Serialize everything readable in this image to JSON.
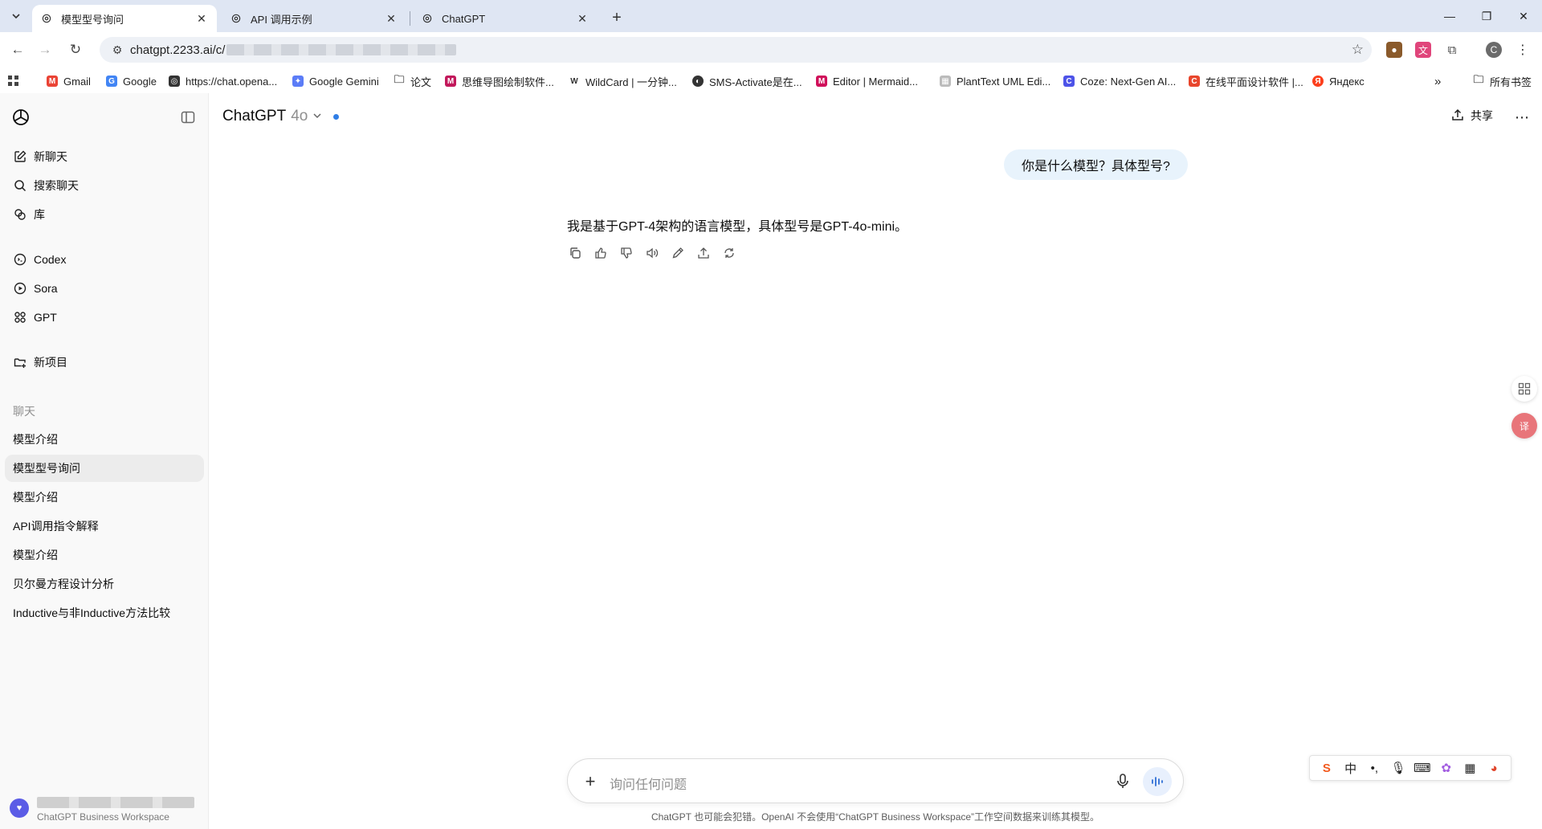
{
  "browser": {
    "tabs": [
      {
        "title": "模型型号询问",
        "active": true
      },
      {
        "title": "API 调用示例",
        "active": false
      },
      {
        "title": "ChatGPT",
        "active": false
      }
    ],
    "url_visible": "chatgpt.2233.ai/c/",
    "bookmarks": [
      {
        "label": "Gmail",
        "icon": "gmail-icon",
        "color": "#ea4335"
      },
      {
        "label": "Google",
        "icon": "google-icon",
        "color": "#4285f4"
      },
      {
        "label": "https://chat.opena...",
        "icon": "openai-icon",
        "color": "#333333"
      },
      {
        "label": "Google Gemini",
        "icon": "gemini-icon",
        "color": "#5b7cf7"
      },
      {
        "label": "论文",
        "icon": "folder-icon",
        "color": "#555555"
      },
      {
        "label": "思维导图绘制软件...",
        "icon": "mindmap-icon",
        "color": "#c2185b"
      },
      {
        "label": "WildCard | 一分钟...",
        "icon": "wildcard-icon",
        "color": "#333333"
      },
      {
        "label": "SMS-Activate是在...",
        "icon": "sms-icon",
        "color": "#333333"
      },
      {
        "label": "Editor | Mermaid...",
        "icon": "mermaid-icon",
        "color": "#d0105a"
      },
      {
        "label": "PlantText UML Edi...",
        "icon": "planttext-icon",
        "color": "#888888"
      },
      {
        "label": "Coze: Next-Gen AI...",
        "icon": "coze-icon",
        "color": "#4d53e8"
      },
      {
        "label": "在线平面设计软件 |...",
        "icon": "design-icon",
        "color": "#e8462c"
      },
      {
        "label": "Яндекс",
        "icon": "yandex-icon",
        "color": "#fc3f1d"
      }
    ],
    "all_bookmarks": "所有书签",
    "profile_initial": "C"
  },
  "sidebar": {
    "nav": [
      {
        "label": "新聊天",
        "icon": "new-chat-icon"
      },
      {
        "label": "搜索聊天",
        "icon": "search-icon"
      },
      {
        "label": "库",
        "icon": "library-icon"
      },
      {
        "label": "Codex",
        "icon": "codex-icon"
      },
      {
        "label": "Sora",
        "icon": "sora-icon"
      },
      {
        "label": "GPT",
        "icon": "gpt-grid-icon"
      },
      {
        "label": "新项目",
        "icon": "new-project-icon"
      }
    ],
    "section_title": "聊天",
    "chats": [
      {
        "label": "模型介绍",
        "active": false
      },
      {
        "label": "模型型号询问",
        "active": true
      },
      {
        "label": "模型介绍",
        "active": false
      },
      {
        "label": "API调用指令解释",
        "active": false
      },
      {
        "label": "模型介绍",
        "active": false
      },
      {
        "label": "贝尔曼方程设计分析",
        "active": false
      },
      {
        "label": "Inductive与非Inductive方法比较",
        "active": false
      }
    ],
    "workspace": "ChatGPT Business Workspace"
  },
  "header": {
    "product": "ChatGPT",
    "model": "4o",
    "share_label": "共享"
  },
  "conversation": {
    "user_message": "你是什么模型？具体型号?",
    "assistant_message": "我是基于GPT-4架构的语言模型，具体型号是GPT-4o-mini。"
  },
  "composer": {
    "placeholder": "询问任何问题",
    "disclaimer": "ChatGPT 也可能会犯错。OpenAI 不会使用“ChatGPT Business Workspace”工作空间数据来训练其模型。"
  },
  "ime": {
    "mode": "中"
  },
  "colors": {
    "accent": "#2f7ee6",
    "user_bubble": "#e8f3fc",
    "sidebar_bg": "#f9f9f9",
    "tabbar_bg": "#dfe6f3"
  }
}
